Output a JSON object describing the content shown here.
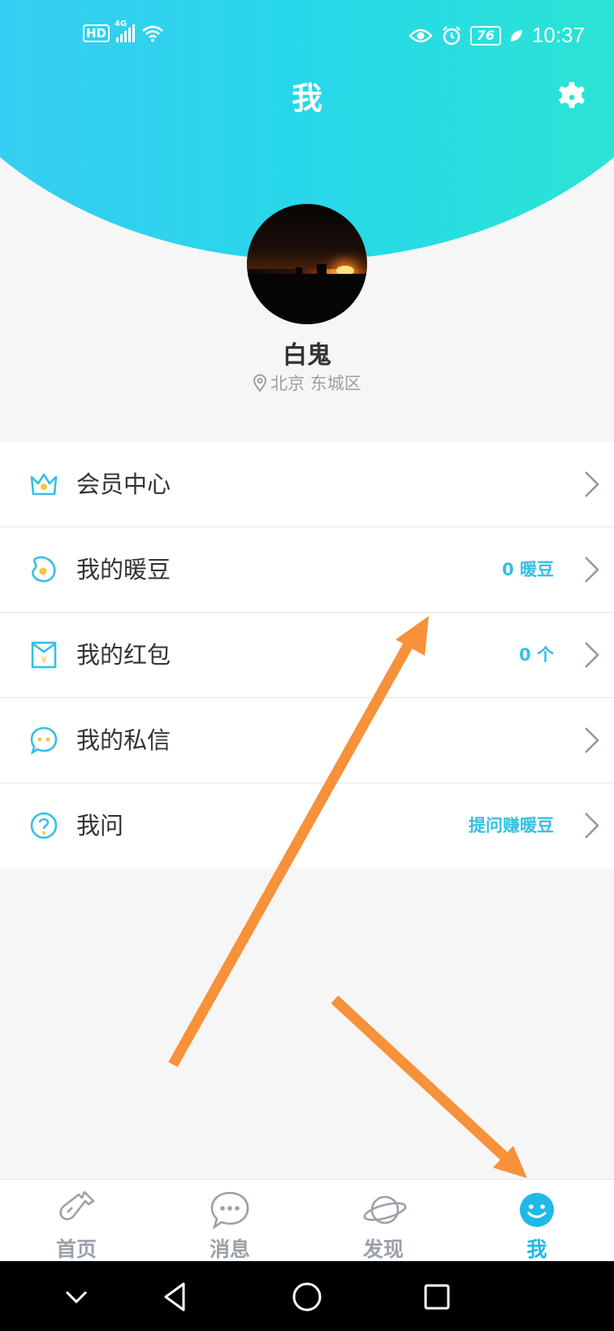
{
  "status_bar": {
    "network_hd": "HD",
    "network_gen": "4G",
    "battery": "76",
    "time": "10:37"
  },
  "header": {
    "title": "我"
  },
  "profile": {
    "name": "白鬼",
    "location": "北京 东城区"
  },
  "menu": {
    "items": [
      {
        "label": "会员中心",
        "value": "",
        "icon": "crown-icon"
      },
      {
        "label": "我的暖豆",
        "value": "0 暖豆",
        "icon": "bean-icon"
      },
      {
        "label": "我的红包",
        "value": "0 个",
        "icon": "red-envelope-icon"
      },
      {
        "label": "我的私信",
        "value": "",
        "icon": "chat-bubble-icon"
      },
      {
        "label": "我问",
        "value": "提问赚暖豆",
        "icon": "question-icon"
      }
    ]
  },
  "tabs": [
    {
      "label": "首页",
      "icon": "bottle-icon",
      "active": false
    },
    {
      "label": "消息",
      "icon": "message-icon",
      "active": false
    },
    {
      "label": "发现",
      "icon": "planet-icon",
      "active": false
    },
    {
      "label": "我",
      "icon": "smiley-icon",
      "active": true
    }
  ],
  "colors": {
    "accent": "#1fb9e8",
    "header_gradient_start": "#3dc9f5",
    "header_gradient_end": "#2ce9cd",
    "annotation_arrow": "#f7913a"
  }
}
